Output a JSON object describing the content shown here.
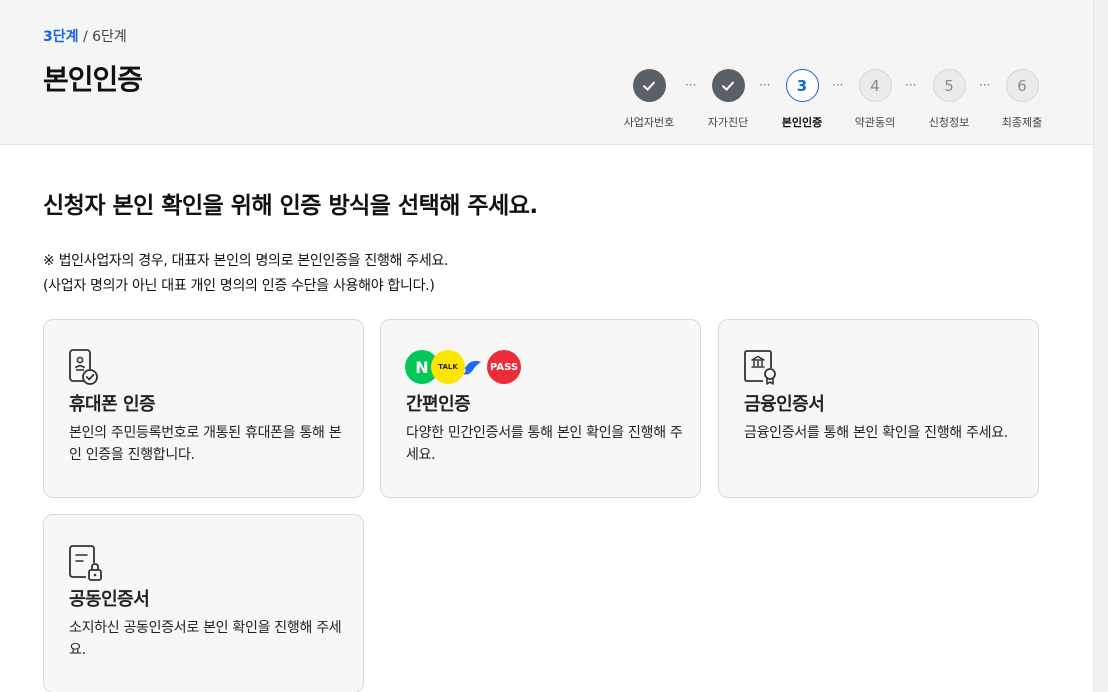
{
  "progress": {
    "current": "3단계",
    "separator": " / ",
    "total": "6단계"
  },
  "page_title": "본인인증",
  "stepper": [
    {
      "label": "사업자번호",
      "number": "",
      "state": "done"
    },
    {
      "label": "자가진단",
      "number": "",
      "state": "done"
    },
    {
      "label": "본인인증",
      "number": "3",
      "state": "current"
    },
    {
      "label": "약관동의",
      "number": "4",
      "state": "todo"
    },
    {
      "label": "신청정보",
      "number": "5",
      "state": "todo"
    },
    {
      "label": "최종제출",
      "number": "6",
      "state": "todo"
    }
  ],
  "stepper_dots": "···",
  "heading": "신청자 본인 확인을 위해 인증 방식을 선택해 주세요.",
  "note": {
    "line1": "※ 법인사업자의 경우, 대표자 본인의 명의로 본인인증을 진행해 주세요.",
    "line2": "(사업자 명의가 아닌 대표 개인 명의의 인증 수단을 사용해야 합니다.)"
  },
  "methods": [
    {
      "title": "휴대폰 인증",
      "desc": "본인의 주민등록번호로 개통된 휴대폰을 통해 본인 인증을 진행합니다.",
      "icon": "phone-check-icon"
    },
    {
      "title": "간편인증",
      "desc": "다양한 민간인증서를 통해 본인 확인을 진행해 주세요.",
      "icon": "simple-auth-brands",
      "brands": [
        {
          "name": "naver",
          "text": "N",
          "color": "#03c75a"
        },
        {
          "name": "kakao",
          "text": "TALK",
          "color": "#fee500"
        },
        {
          "name": "toss",
          "text": "",
          "color": "#1e6cf5"
        },
        {
          "name": "pass",
          "text": "PASS",
          "color": "#ed2c3a"
        }
      ]
    },
    {
      "title": "금융인증서",
      "desc": "금융인증서를 통해 본인 확인을 진행해 주세요.",
      "icon": "bank-certificate-icon"
    },
    {
      "title": "공동인증서",
      "desc": "소지하신 공동인증서로 본인 확인을 진행해 주세요.",
      "icon": "document-lock-icon"
    }
  ],
  "colors": {
    "accent": "#1565e0",
    "done": "#5a6068",
    "header_bg": "#f5f5f5",
    "card_bg": "#f7f7f7"
  }
}
